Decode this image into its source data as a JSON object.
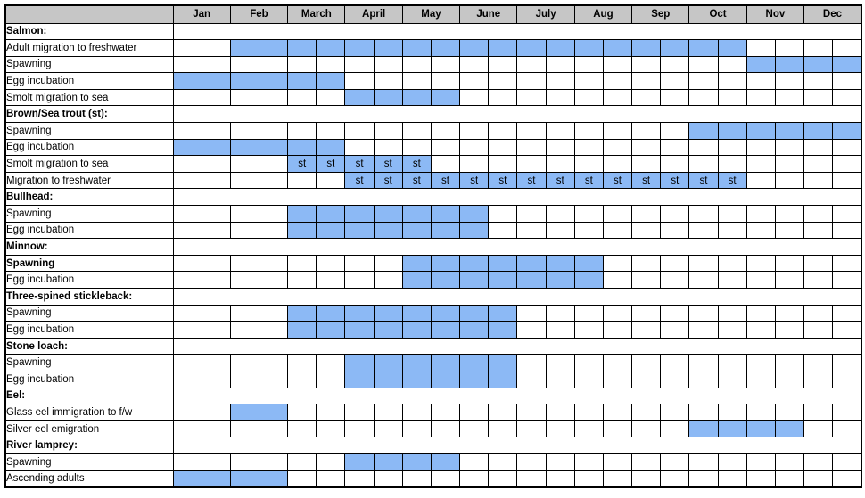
{
  "table": {
    "corner_label": "",
    "months": [
      "Jan",
      "Feb",
      "March",
      "April",
      "May",
      "June",
      "July",
      "Aug",
      "Sep",
      "Oct",
      "Nov",
      "Dec"
    ],
    "half_months_per_month": 2,
    "total_columns": 24,
    "colors": {
      "header_background": "#c6c6c6",
      "filled_cell": "#8cb9f5",
      "empty_cell": "#ffffff",
      "border": "#000000",
      "text": "#000000"
    },
    "marker_label": "st",
    "rows": [
      {
        "label": "Salmon:",
        "type": "section",
        "bold": true,
        "spans": []
      },
      {
        "label": "Adult migration to freshwater",
        "type": "activity",
        "bold": false,
        "spans": [
          {
            "start": 3,
            "end": 20,
            "marker": ""
          }
        ]
      },
      {
        "label": "Spawning",
        "type": "activity",
        "bold": false,
        "spans": [
          {
            "start": 21,
            "end": 24,
            "marker": ""
          }
        ]
      },
      {
        "label": "Egg incubation",
        "type": "activity",
        "bold": false,
        "spans": [
          {
            "start": 1,
            "end": 6,
            "marker": ""
          }
        ]
      },
      {
        "label": "Smolt migration to sea",
        "type": "activity",
        "bold": false,
        "spans": [
          {
            "start": 7,
            "end": 10,
            "marker": ""
          }
        ]
      },
      {
        "label": "Brown/Sea trout (st):",
        "type": "section",
        "bold": true,
        "spans": []
      },
      {
        "label": "Spawning",
        "type": "activity",
        "bold": false,
        "spans": [
          {
            "start": 19,
            "end": 24,
            "marker": ""
          }
        ]
      },
      {
        "label": "Egg incubation",
        "type": "activity",
        "bold": false,
        "spans": [
          {
            "start": 1,
            "end": 6,
            "marker": ""
          }
        ]
      },
      {
        "label": "Smolt migration to sea",
        "type": "activity",
        "bold": false,
        "spans": [
          {
            "start": 5,
            "end": 9,
            "marker": "st"
          }
        ]
      },
      {
        "label": "Migration to freshwater",
        "type": "activity",
        "bold": false,
        "spans": [
          {
            "start": 7,
            "end": 20,
            "marker": "st"
          }
        ]
      },
      {
        "label": "Bullhead:",
        "type": "section",
        "bold": true,
        "spans": []
      },
      {
        "label": "Spawning",
        "type": "activity",
        "bold": false,
        "spans": [
          {
            "start": 5,
            "end": 11,
            "marker": ""
          }
        ]
      },
      {
        "label": "Egg incubation",
        "type": "activity",
        "bold": false,
        "spans": [
          {
            "start": 5,
            "end": 11,
            "marker": ""
          }
        ]
      },
      {
        "label": "Minnow:",
        "type": "section",
        "bold": true,
        "spans": []
      },
      {
        "label": "Spawning",
        "type": "activity",
        "bold": true,
        "spans": [
          {
            "start": 9,
            "end": 15,
            "marker": ""
          }
        ]
      },
      {
        "label": "Egg incubation",
        "type": "activity",
        "bold": false,
        "spans": [
          {
            "start": 9,
            "end": 15,
            "marker": ""
          }
        ]
      },
      {
        "label": "Three-spined stickleback:",
        "type": "section",
        "bold": true,
        "spans": []
      },
      {
        "label": "Spawning",
        "type": "activity",
        "bold": false,
        "spans": [
          {
            "start": 5,
            "end": 12,
            "marker": ""
          }
        ]
      },
      {
        "label": "Egg incubation",
        "type": "activity",
        "bold": false,
        "spans": [
          {
            "start": 5,
            "end": 12,
            "marker": ""
          }
        ]
      },
      {
        "label": "Stone loach:",
        "type": "section",
        "bold": true,
        "spans": []
      },
      {
        "label": "Spawning",
        "type": "activity",
        "bold": false,
        "spans": [
          {
            "start": 7,
            "end": 12,
            "marker": ""
          }
        ]
      },
      {
        "label": "Egg incubation",
        "type": "activity",
        "bold": false,
        "spans": [
          {
            "start": 7,
            "end": 12,
            "marker": ""
          }
        ]
      },
      {
        "label": "Eel:",
        "type": "section",
        "bold": true,
        "spans": []
      },
      {
        "label": "Glass eel immigration to f/w",
        "type": "activity",
        "bold": false,
        "spans": [
          {
            "start": 3,
            "end": 4,
            "marker": ""
          }
        ]
      },
      {
        "label": "Silver eel emigration",
        "type": "activity",
        "bold": false,
        "spans": [
          {
            "start": 19,
            "end": 22,
            "marker": ""
          }
        ]
      },
      {
        "label": "River lamprey:",
        "type": "section",
        "bold": true,
        "spans": []
      },
      {
        "label": "Spawning",
        "type": "activity",
        "bold": false,
        "spans": [
          {
            "start": 7,
            "end": 10,
            "marker": ""
          }
        ]
      },
      {
        "label": "Ascending adults",
        "type": "activity",
        "bold": false,
        "spans": [
          {
            "start": 1,
            "end": 4,
            "marker": ""
          }
        ]
      }
    ]
  }
}
